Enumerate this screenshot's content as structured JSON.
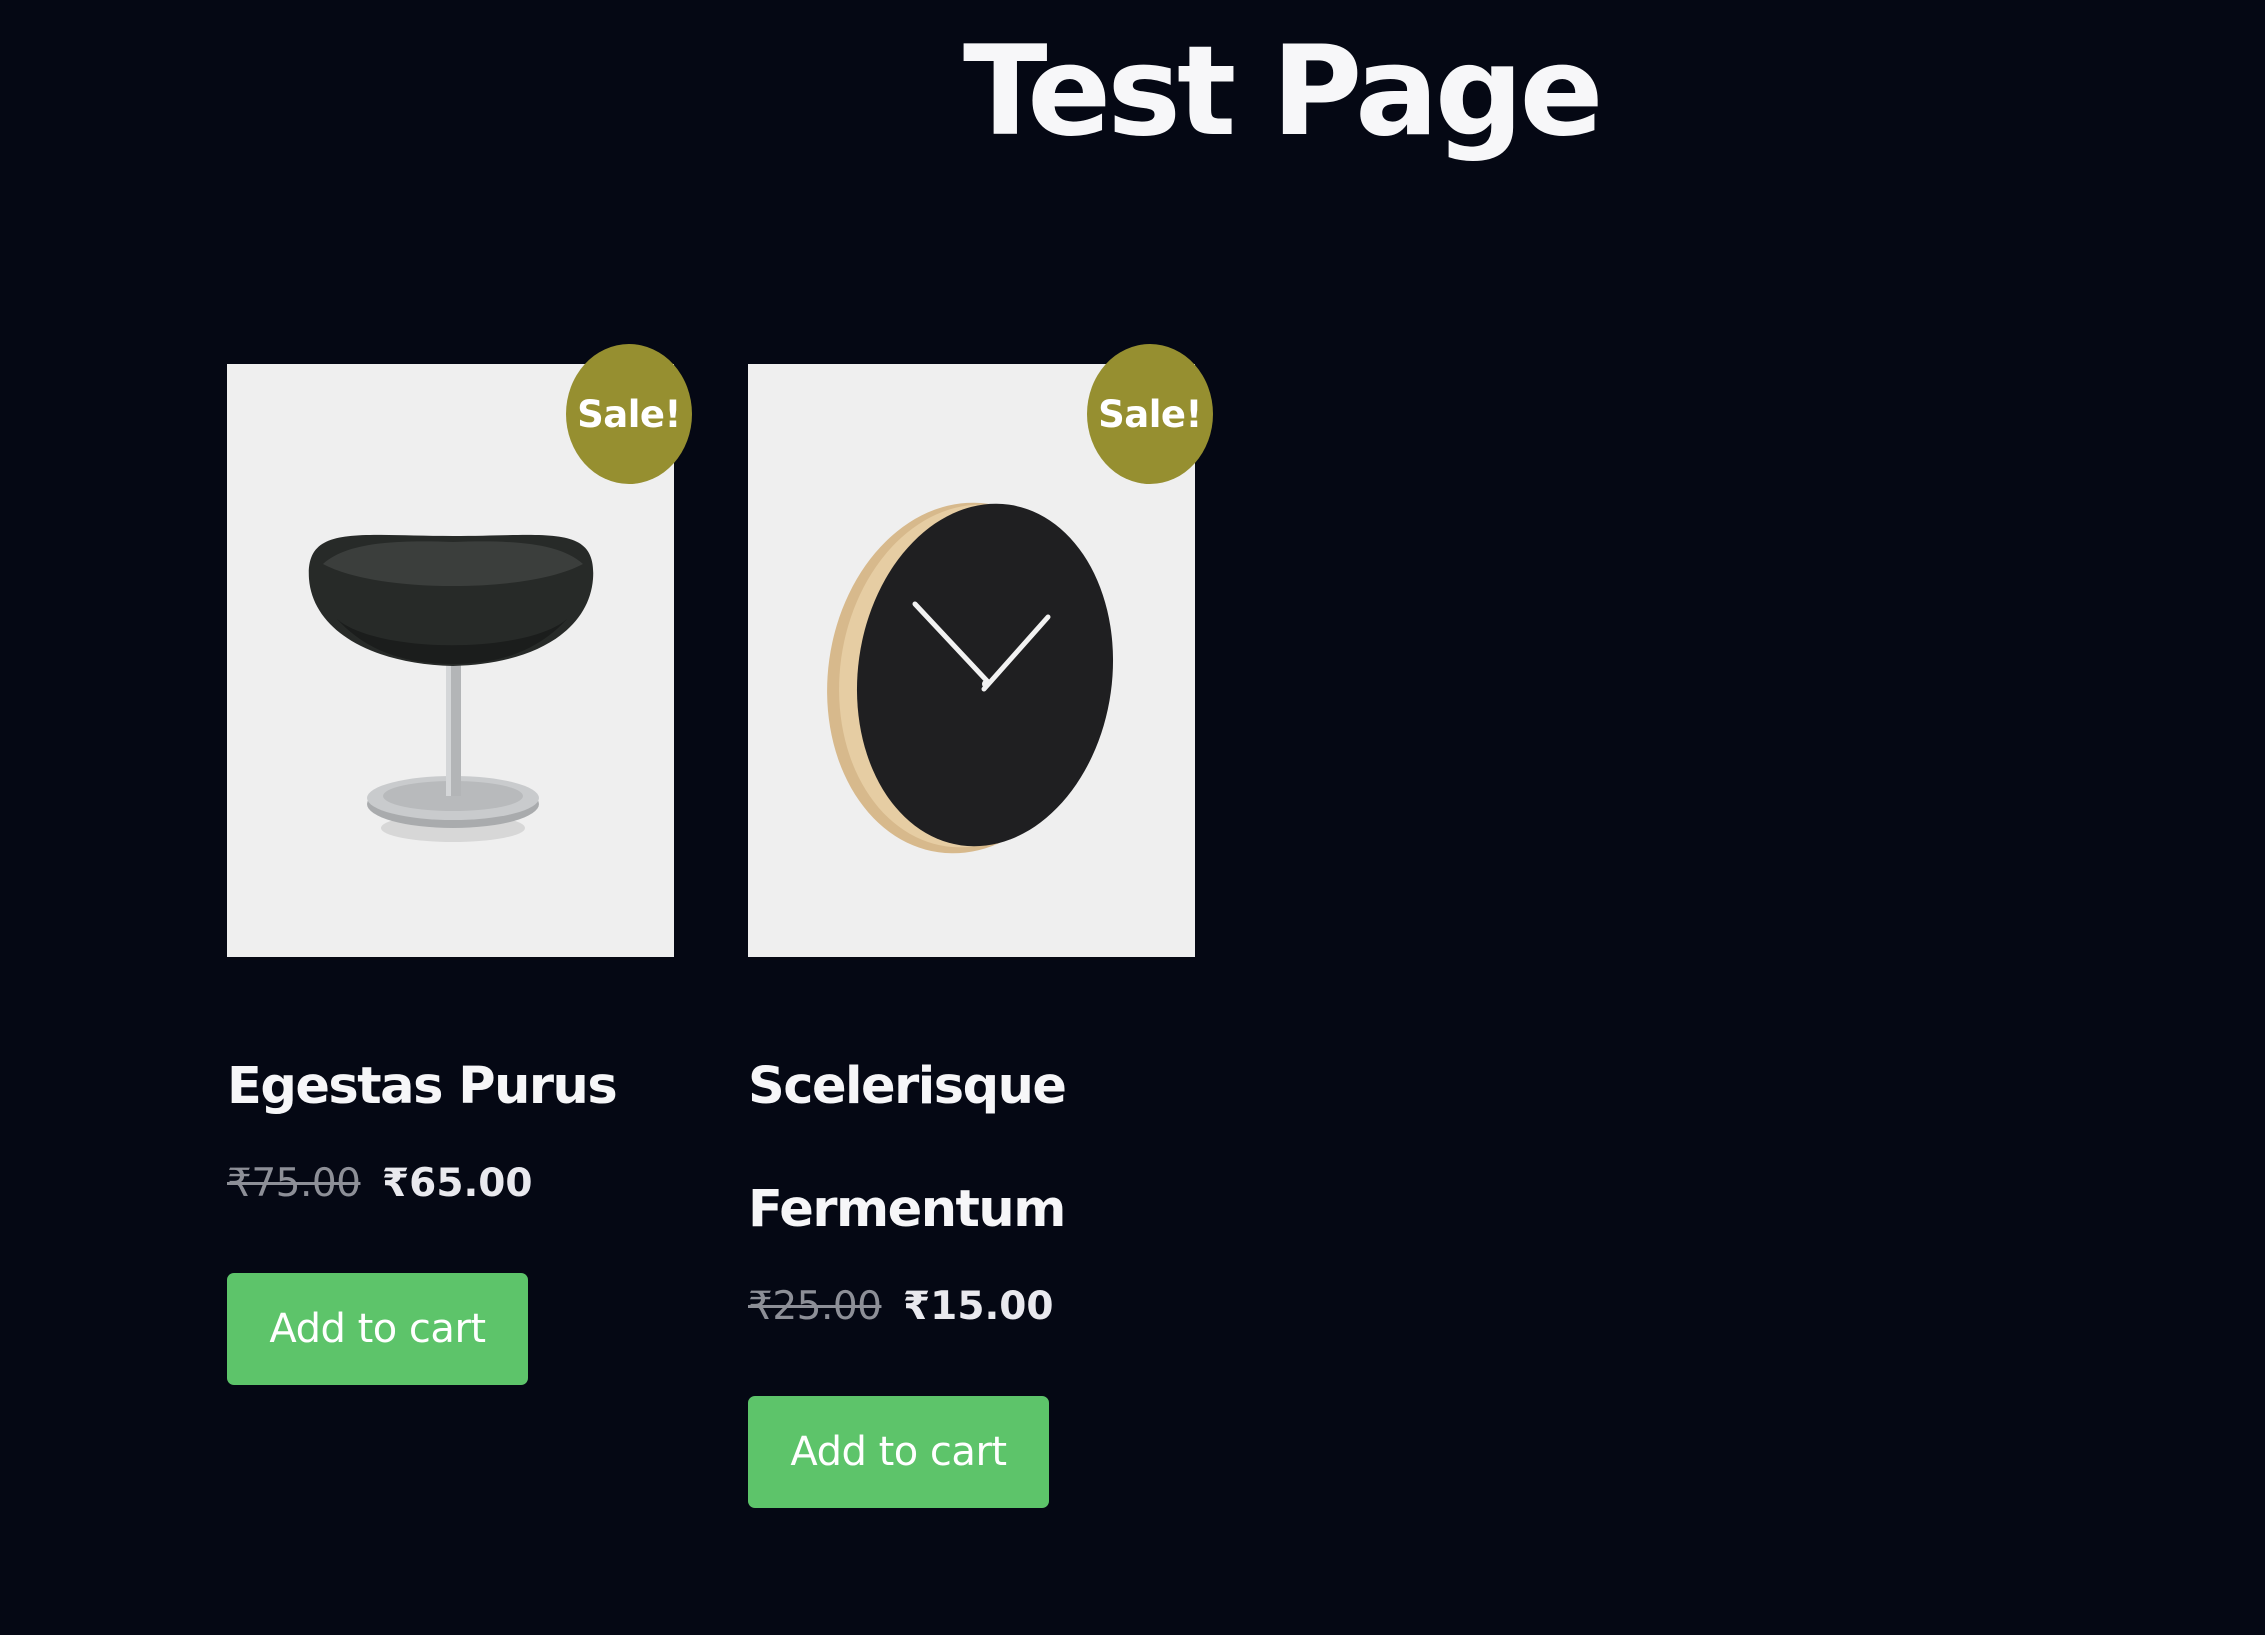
{
  "page": {
    "title": "Test Page"
  },
  "colors": {
    "background": "#050814",
    "sale_badge": "#968f30",
    "button": "#5dc46a",
    "thumbnail_bg": "#efefef"
  },
  "products": [
    {
      "name": "Egestas Purus",
      "image_icon": "lounge-chair",
      "badge": "Sale!",
      "price_old": "₹75.00",
      "price_new": "₹65.00",
      "button_label": "Add to cart"
    },
    {
      "name": "Scelerisque Fermentum",
      "image_icon": "wall-clock",
      "badge": "Sale!",
      "price_old": "₹25.00",
      "price_new": "₹15.00",
      "button_label": "Add to cart"
    }
  ]
}
